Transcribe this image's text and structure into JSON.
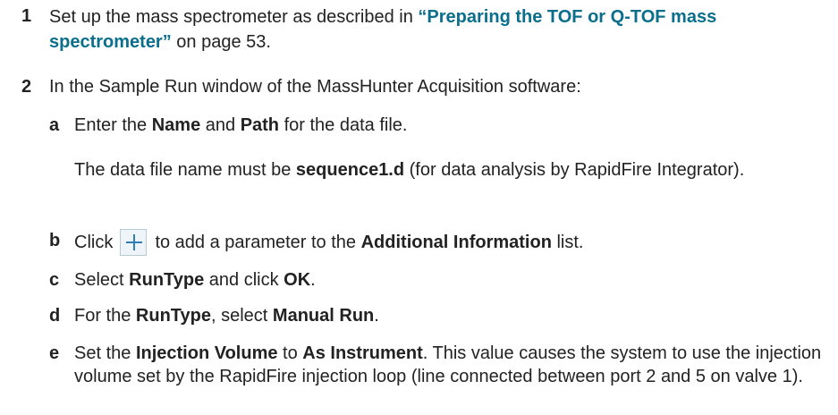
{
  "steps": [
    {
      "number": "1",
      "text_before": "Set up the mass spectrometer as described in ",
      "link": "“Preparing the TOF or Q-TOF mass spectrometer”",
      "text_after": " on page 53."
    },
    {
      "number": "2",
      "text": "In the Sample Run window of the MassHunter Acquisition software:",
      "substeps": [
        {
          "letter": "a",
          "t1": "Enter the ",
          "b1": "Name",
          "t2": " and ",
          "b2": "Path",
          "t3": " for the data file.",
          "note_t1": "The data file name must be ",
          "note_b1": "sequence1.d",
          "note_t2": " (for data analysis by RapidFire Integrator)."
        },
        {
          "letter": "b",
          "t1": "Click ",
          "icon": "plus-icon",
          "t2": " to add a parameter to the ",
          "b1": "Additional Information",
          "t3": " list."
        },
        {
          "letter": "c",
          "t1": "Select ",
          "b1": "RunType",
          "t2": " and click ",
          "b2": "OK",
          "t3": "."
        },
        {
          "letter": "d",
          "t1": "For the ",
          "b1": "RunType",
          "t2": ", select ",
          "b2": "Manual Run",
          "t3": "."
        },
        {
          "letter": "e",
          "t1": "Set the ",
          "b1": "Injection Volume",
          "t2": " to ",
          "b2": "As Instrument",
          "t3": ". This value causes the system to use the injection volume set by the RapidFire injection loop (line connected between port 2 and 5 on valve 1)."
        }
      ]
    }
  ]
}
